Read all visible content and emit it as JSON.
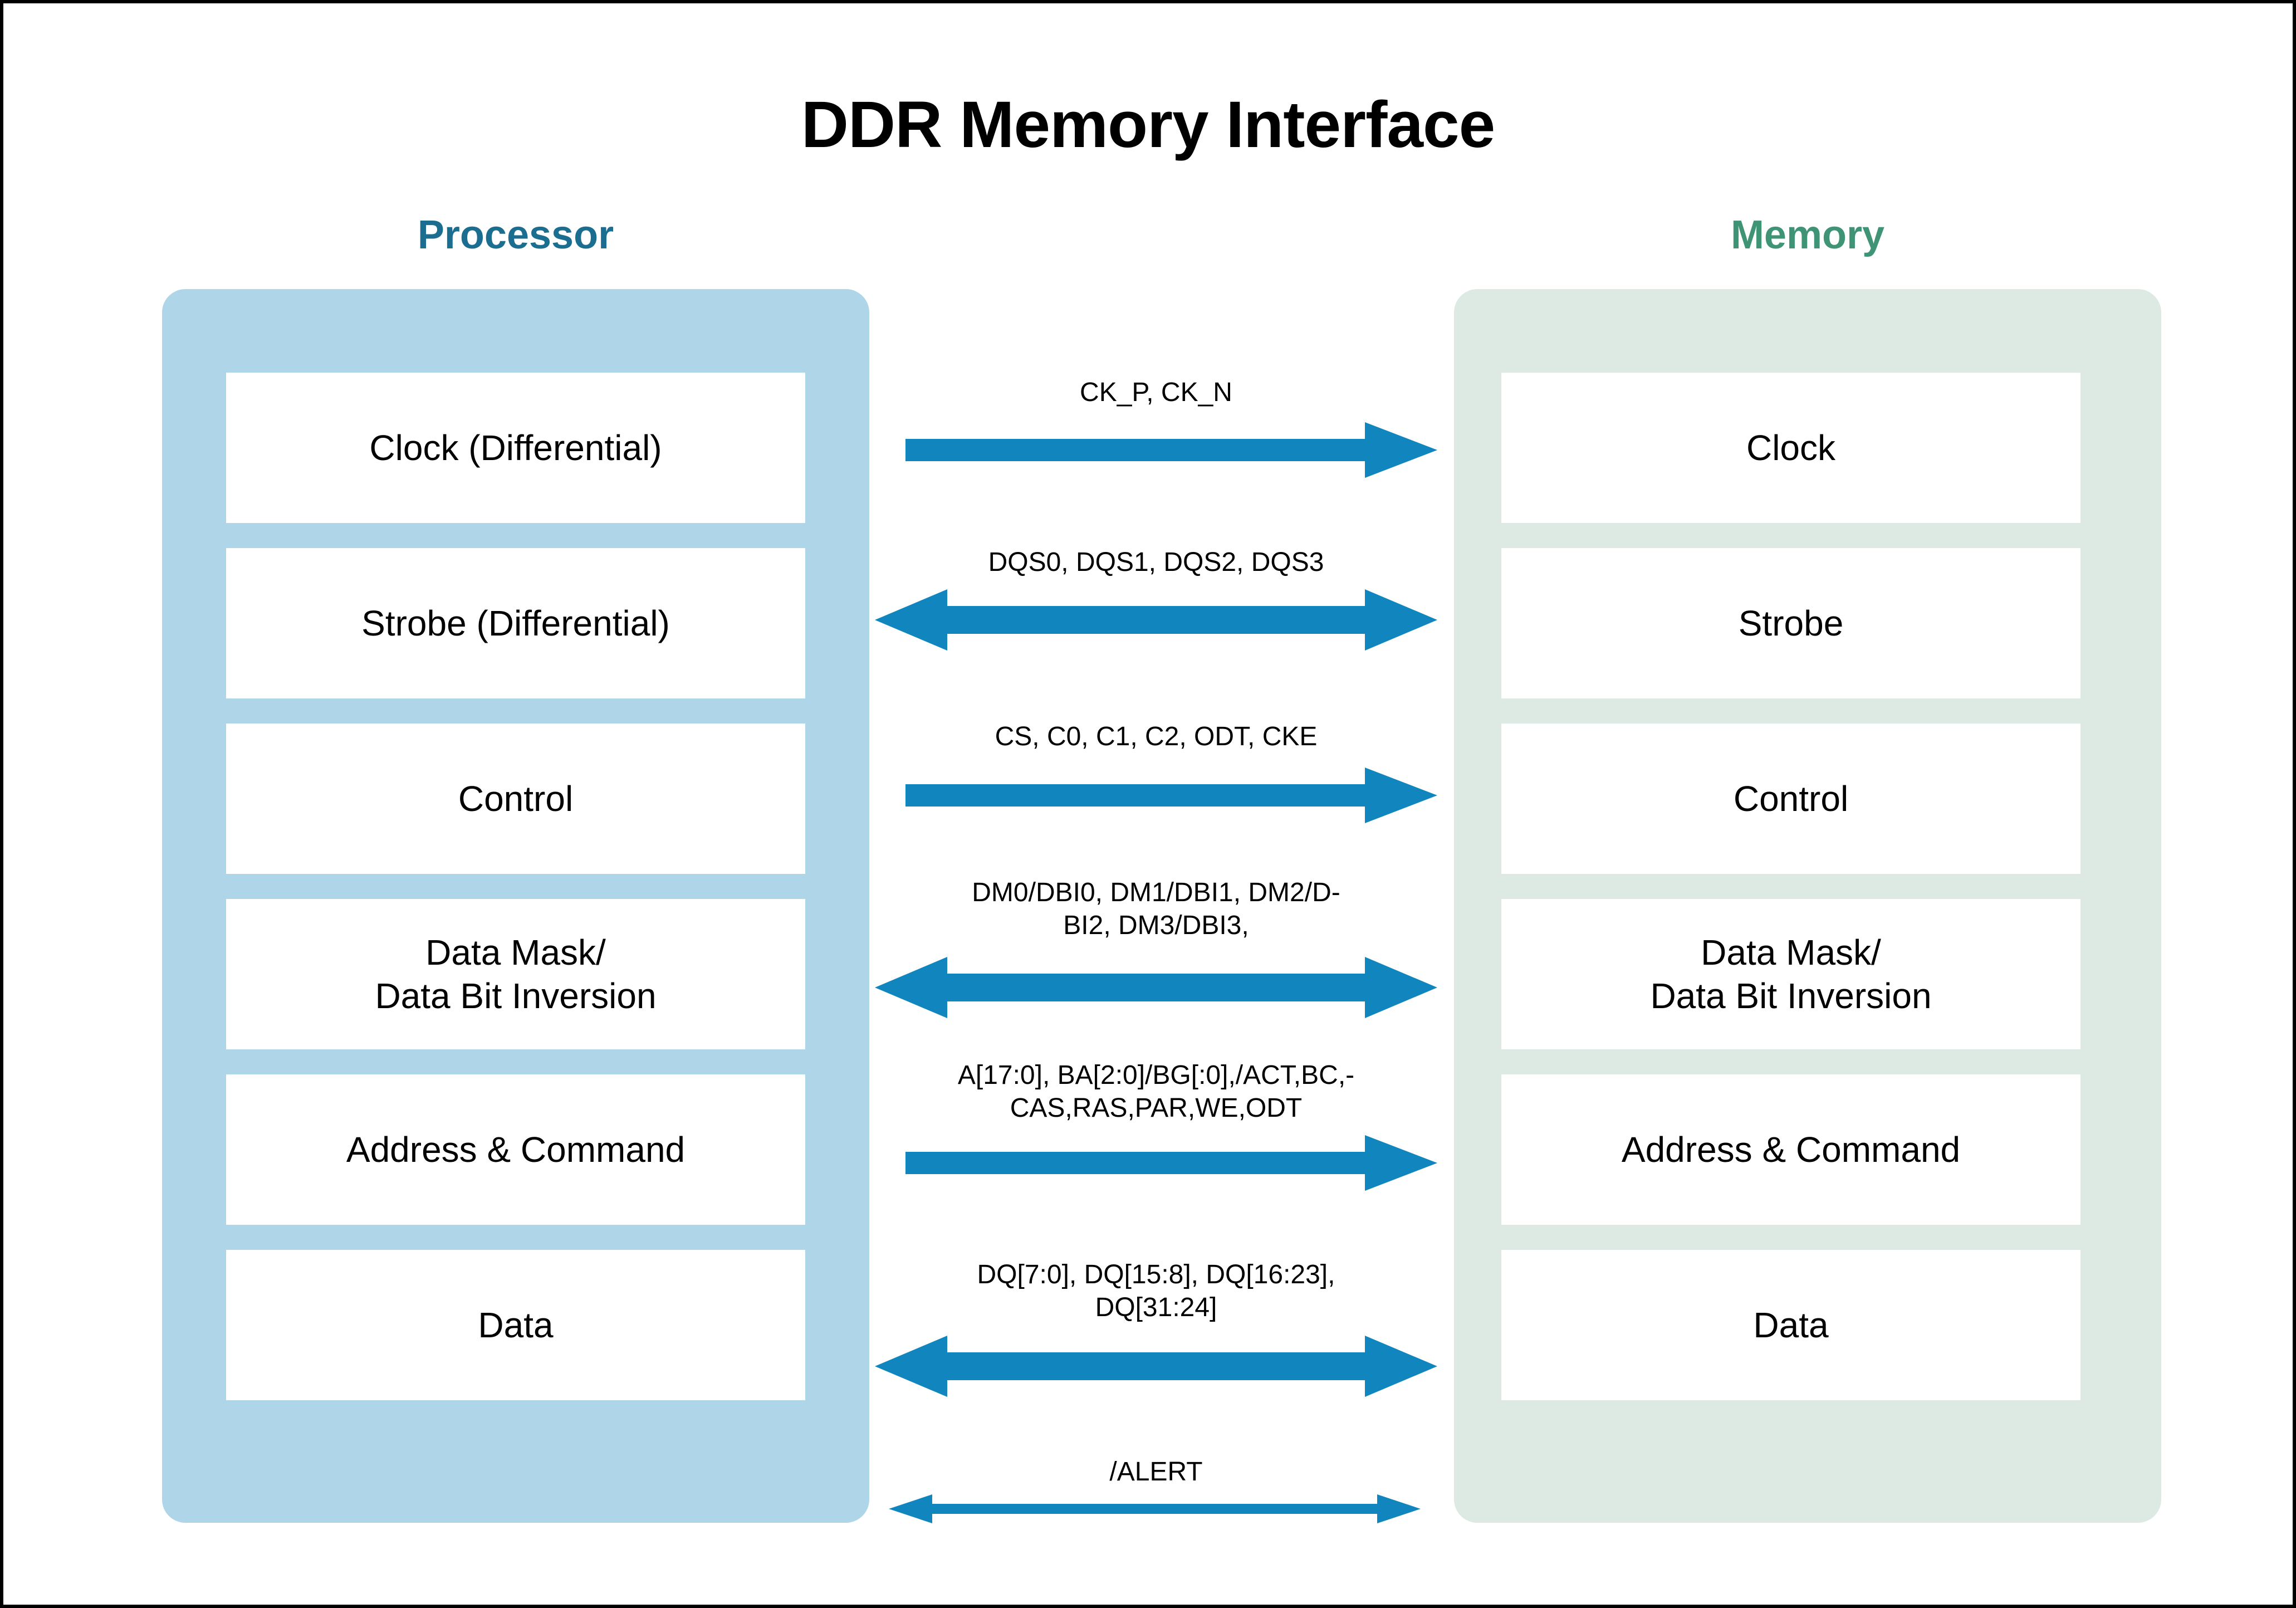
{
  "diagram": {
    "title": "DDR Memory Interface",
    "colors": {
      "arrow_blue": "#1186be",
      "processor_panel": "#aed5e8",
      "processor_heading": "#1c6e91",
      "memory_panel": "#dde9e3",
      "memory_heading": "#3e9475",
      "block_fill": "#ffffff",
      "text": "#000000",
      "border": "#000000"
    }
  },
  "processor": {
    "heading": "Processor",
    "blocks": [
      {
        "label": "Clock (Differential)"
      },
      {
        "label": "Strobe (Differential)"
      },
      {
        "label": "Control"
      },
      {
        "label": "Data Mask/\nData Bit Inversion"
      },
      {
        "label": "Address & Command"
      },
      {
        "label": "Data"
      }
    ]
  },
  "memory": {
    "heading": "Memory",
    "blocks": [
      {
        "label": "Clock"
      },
      {
        "label": "Strobe"
      },
      {
        "label": "Control"
      },
      {
        "label": "Data Mask/\nData Bit Inversion"
      },
      {
        "label": "Address & Command"
      },
      {
        "label": "Data"
      }
    ]
  },
  "signals": [
    {
      "name": "clock",
      "label": "CK_P, CK_N",
      "direction": "right",
      "style": "block"
    },
    {
      "name": "strobe",
      "label": "DQS0, DQS1, DQS2, DQS3",
      "direction": "bidirectional",
      "style": "block"
    },
    {
      "name": "control",
      "label": "CS, C0, C1, C2, ODT, CKE",
      "direction": "right",
      "style": "block"
    },
    {
      "name": "data-mask",
      "label": "DM0/DBI0, DM1/DBI1, DM2/D-\nBI2, DM3/DBI3,",
      "direction": "bidirectional",
      "style": "block"
    },
    {
      "name": "address-command",
      "label": "A[17:0], BA[2:0]/BG[:0],/ACT,BC,-\nCAS,RAS,PAR,WE,ODT",
      "direction": "right",
      "style": "block"
    },
    {
      "name": "data",
      "label": "DQ[7:0], DQ[15:8], DQ[16:23],\nDQ[31:24]",
      "direction": "bidirectional",
      "style": "block"
    },
    {
      "name": "alert",
      "label": "/ALERT",
      "direction": "bidirectional",
      "style": "thin"
    }
  ]
}
